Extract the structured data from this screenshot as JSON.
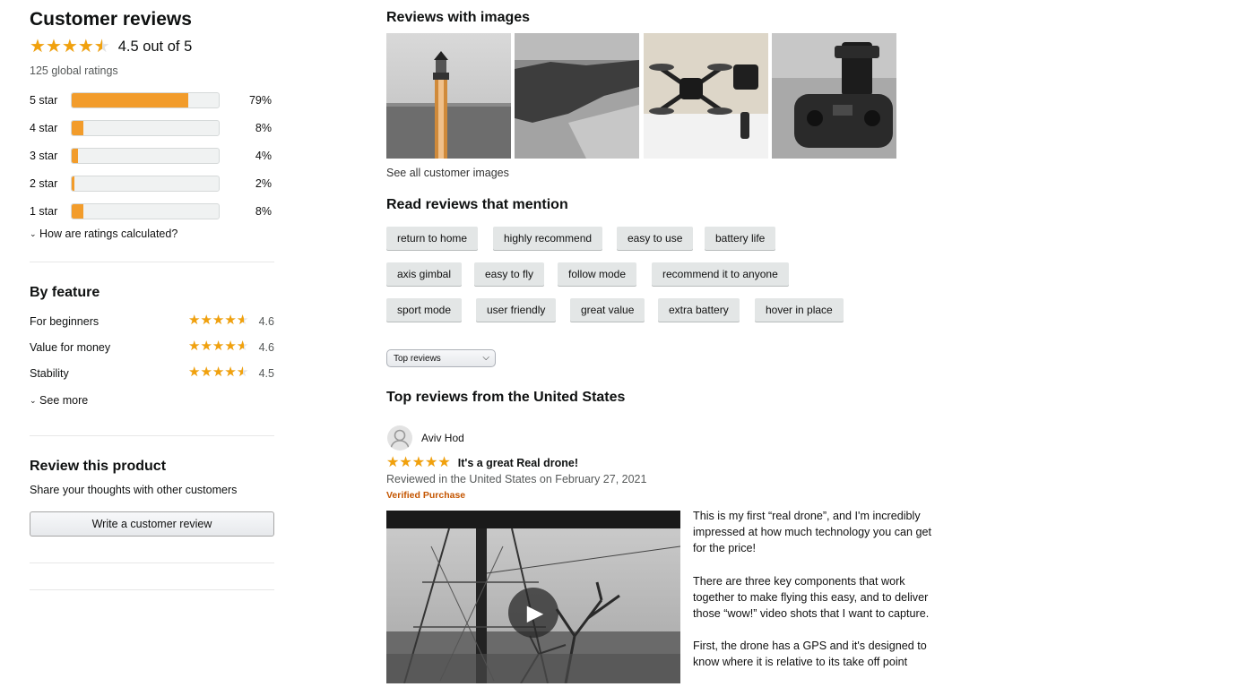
{
  "summary": {
    "title": "Customer reviews",
    "rating_text": "4.5 out of 5",
    "rating_value": 4.5,
    "global_ratings": "125 global ratings",
    "histogram": [
      {
        "label": "5 star",
        "pct": "79%",
        "value": 0.79
      },
      {
        "label": "4 star",
        "pct": "8%",
        "value": 0.08
      },
      {
        "label": "3 star",
        "pct": "4%",
        "value": 0.04
      },
      {
        "label": "2 star",
        "pct": "2%",
        "value": 0.02
      },
      {
        "label": "1 star",
        "pct": "8%",
        "value": 0.08
      }
    ],
    "how_calculated": "How are ratings calculated?"
  },
  "by_feature": {
    "title": "By feature",
    "items": [
      {
        "name": "For beginners",
        "value": "4.6",
        "rating": 4.6
      },
      {
        "name": "Value for money",
        "value": "4.6",
        "rating": 4.6
      },
      {
        "name": "Stability",
        "value": "4.5",
        "rating": 4.5
      }
    ],
    "see_more": "See more"
  },
  "review_product": {
    "title": "Review this product",
    "subtitle": "Share your thoughts with other customers",
    "button": "Write a customer review"
  },
  "images_section": {
    "title": "Reviews with images",
    "see_all": "See all customer images",
    "thumbnails": [
      "lighthouse-photo",
      "coastline-aerial-photo",
      "drone-photo",
      "remote-controller-photo"
    ]
  },
  "mentions": {
    "title": "Read reviews that mention",
    "rows": [
      [
        "return to home",
        "highly recommend",
        "easy to use",
        "battery life"
      ],
      [
        "axis gimbal",
        "easy to fly",
        "follow mode",
        "recommend it to anyone"
      ],
      [
        "sport mode",
        "user friendly",
        "great value",
        "extra battery",
        "hover in place"
      ]
    ]
  },
  "sort": {
    "selected": "Top reviews"
  },
  "top_reviews": {
    "title": "Top reviews from the United States",
    "review": {
      "author": "Aviv Hod",
      "rating": 5,
      "headline": "It's a great Real drone!",
      "date": "Reviewed in the United States on February 27, 2021",
      "badge": "Verified Purchase",
      "paragraphs": [
        " This is my first “real drone”, and I'm incredibly impressed at how much technology you can get for the price!",
        "There are three key components that work together to make flying this easy, and to deliver those “wow!” video shots that I want to capture.",
        "First, the drone has a GPS and it's designed to know where it is relative to its take off point"
      ]
    }
  },
  "colors": {
    "star": "#f1a10d",
    "bar": "#f29c2b",
    "verified": "#c45500"
  }
}
